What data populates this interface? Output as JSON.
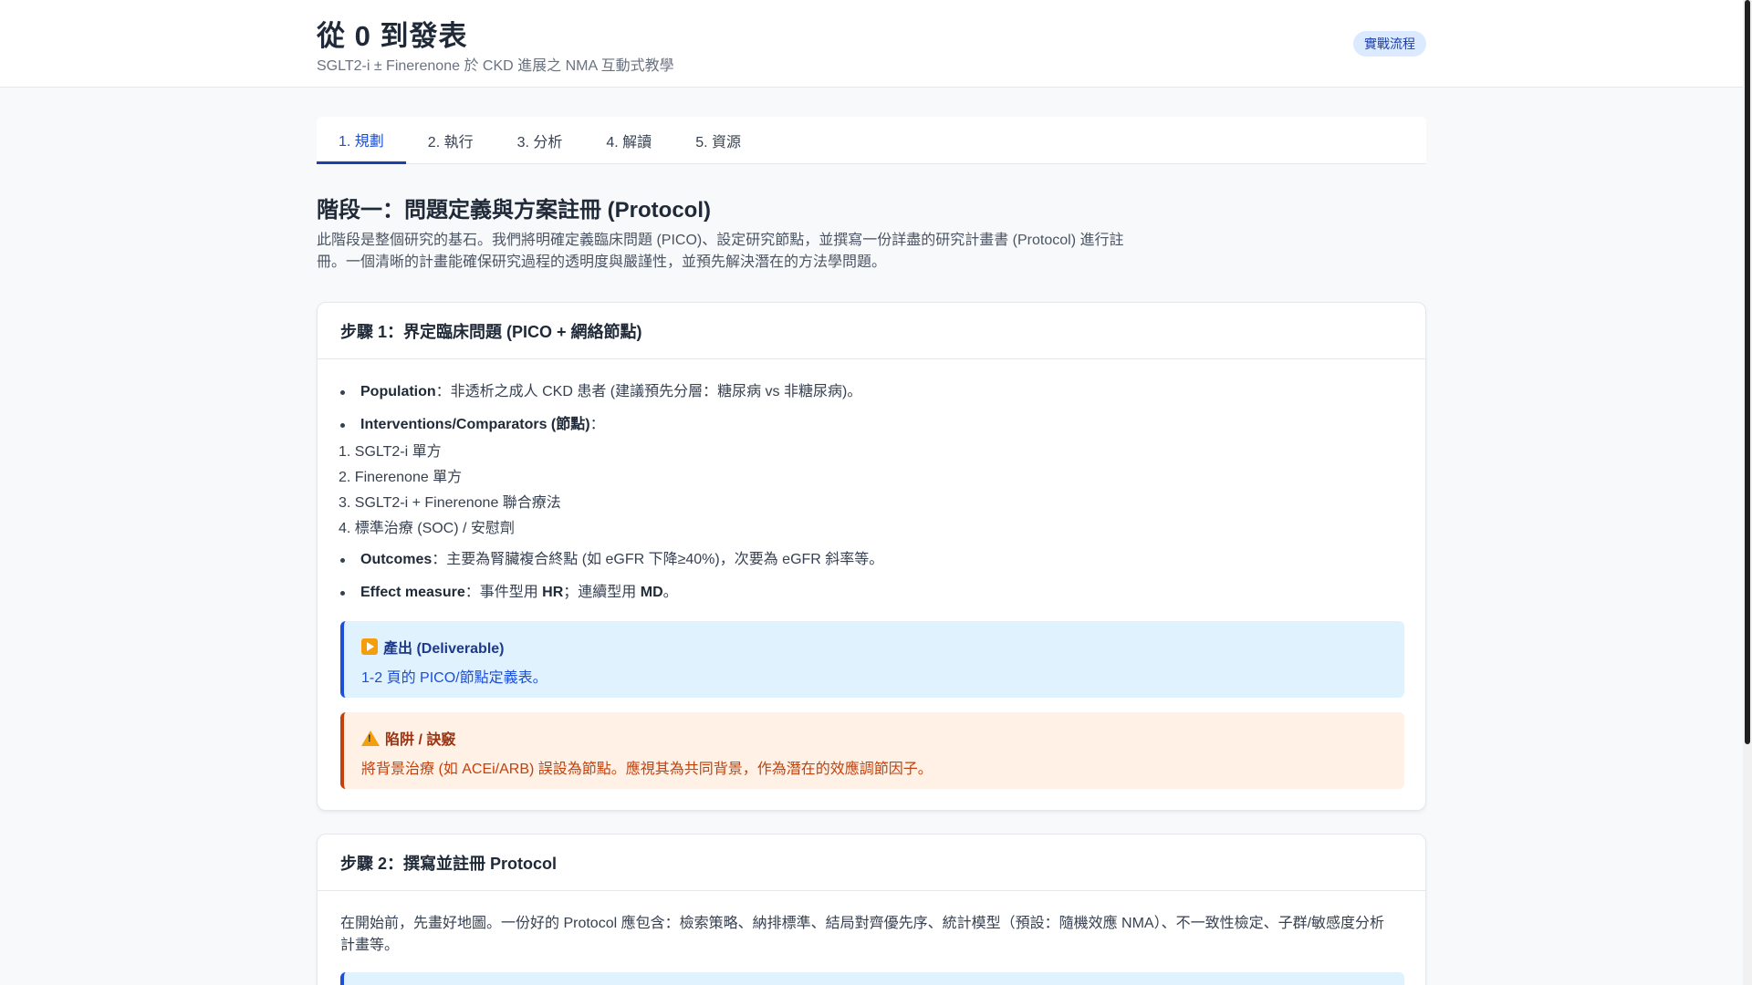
{
  "header": {
    "title": "從 0 到發表",
    "subtitle": "SGLT2-i ± Finerenone 於 CKD 進展之 NMA 互動式教學",
    "badge": "實戰流程"
  },
  "tabs": [
    {
      "label": "1. 規劃",
      "active": true
    },
    {
      "label": "2. 執行",
      "active": false
    },
    {
      "label": "3. 分析",
      "active": false
    },
    {
      "label": "4. 解讀",
      "active": false
    },
    {
      "label": "5. 資源",
      "active": false
    }
  ],
  "phase": {
    "title": "階段一：問題定義與方案註冊 (Protocol)",
    "description": "此階段是整個研究的基石。我們將明確定義臨床問題 (PICO)、設定研究節點，並撰寫一份詳盡的研究計畫書 (Protocol) 進行註冊。一個清晰的計畫能確保研究過程的透明度與嚴謹性，並預先解決潛在的方法學問題。"
  },
  "step1": {
    "title": "步驟 1：界定臨床問題 (PICO + 網絡節點)",
    "population_label": "Population",
    "population_text": "：非透析之成人 CKD 患者 (建議預先分層：糖尿病 vs 非糖尿病)。",
    "interventions_label": "Interventions/Comparators (節點)",
    "interventions_suffix": "：",
    "nodes": [
      "1. SGLT2-i 單方",
      "2. Finerenone 單方",
      "3. SGLT2-i + Finerenone 聯合療法",
      "4. 標準治療 (SOC) / 安慰劑"
    ],
    "outcomes_label": "Outcomes",
    "outcomes_text": "：主要為腎臟複合終點 (如 eGFR 下降≥40%)，次要為 eGFR 斜率等。",
    "effect_label": "Effect measure",
    "effect_text_1": "：事件型用 ",
    "effect_hr": "HR",
    "effect_text_2": "；連續型用 ",
    "effect_md": "MD",
    "effect_text_3": "。",
    "deliverable_title": "產出 (Deliverable)",
    "deliverable_body": "1-2 頁的 PICO/節點定義表。",
    "pitfall_title": "陷阱 / 訣竅",
    "pitfall_body": "將背景治療 (如 ACEi/ARB) 誤設為節點。應視其為共同背景，作為潛在的效應調節因子。"
  },
  "step2": {
    "title": "步驟 2：撰寫並註冊 Protocol",
    "body": "在開始前，先畫好地圖。一份好的 Protocol 應包含：檢索策略、納排標準、結局對齊優先序、統計模型（預設：隨機效應 NMA）、不一致性檢定、子群/敏感度分析計畫等。"
  },
  "colors": {
    "accent": "#1e40af",
    "deliverable_bg": "#e0f2fe",
    "pitfall_bg": "#fff1e6",
    "pitfall_text": "#c2410c"
  },
  "icons": {
    "deliverable": "play-icon",
    "pitfall": "warning-icon"
  }
}
